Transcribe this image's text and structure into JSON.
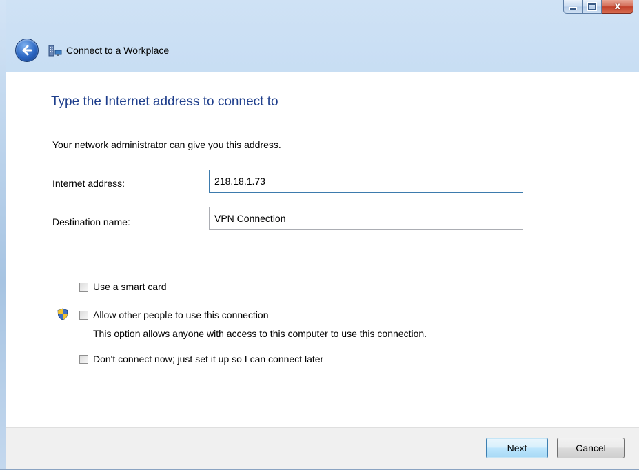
{
  "window": {
    "title": "Connect to a Workplace",
    "close_glyph": "x"
  },
  "content": {
    "main_instruction": "Type the Internet address to connect to",
    "description": "Your network administrator can give you this address.",
    "internet_address": {
      "label": "Internet address:",
      "value": "218.18.1.73"
    },
    "destination_name": {
      "label": "Destination name:",
      "value": "VPN Connection"
    }
  },
  "options": {
    "smart_card": {
      "label": "Use a smart card",
      "checked": false
    },
    "allow_others": {
      "label": "Allow other people to use this connection",
      "note": "This option allows anyone with access to this computer to use this connection.",
      "checked": false
    },
    "connect_later": {
      "label": "Don't connect now; just set it up so I can connect later",
      "checked": false
    }
  },
  "footer": {
    "next_label": "Next",
    "cancel_label": "Cancel"
  },
  "colors": {
    "instruction_text": "#1e3e8c",
    "accent_button_border": "#3c7fb1"
  },
  "icons": {
    "back": "back-arrow-icon",
    "title": "workplace-network-icon",
    "shield": "uac-shield-icon"
  }
}
